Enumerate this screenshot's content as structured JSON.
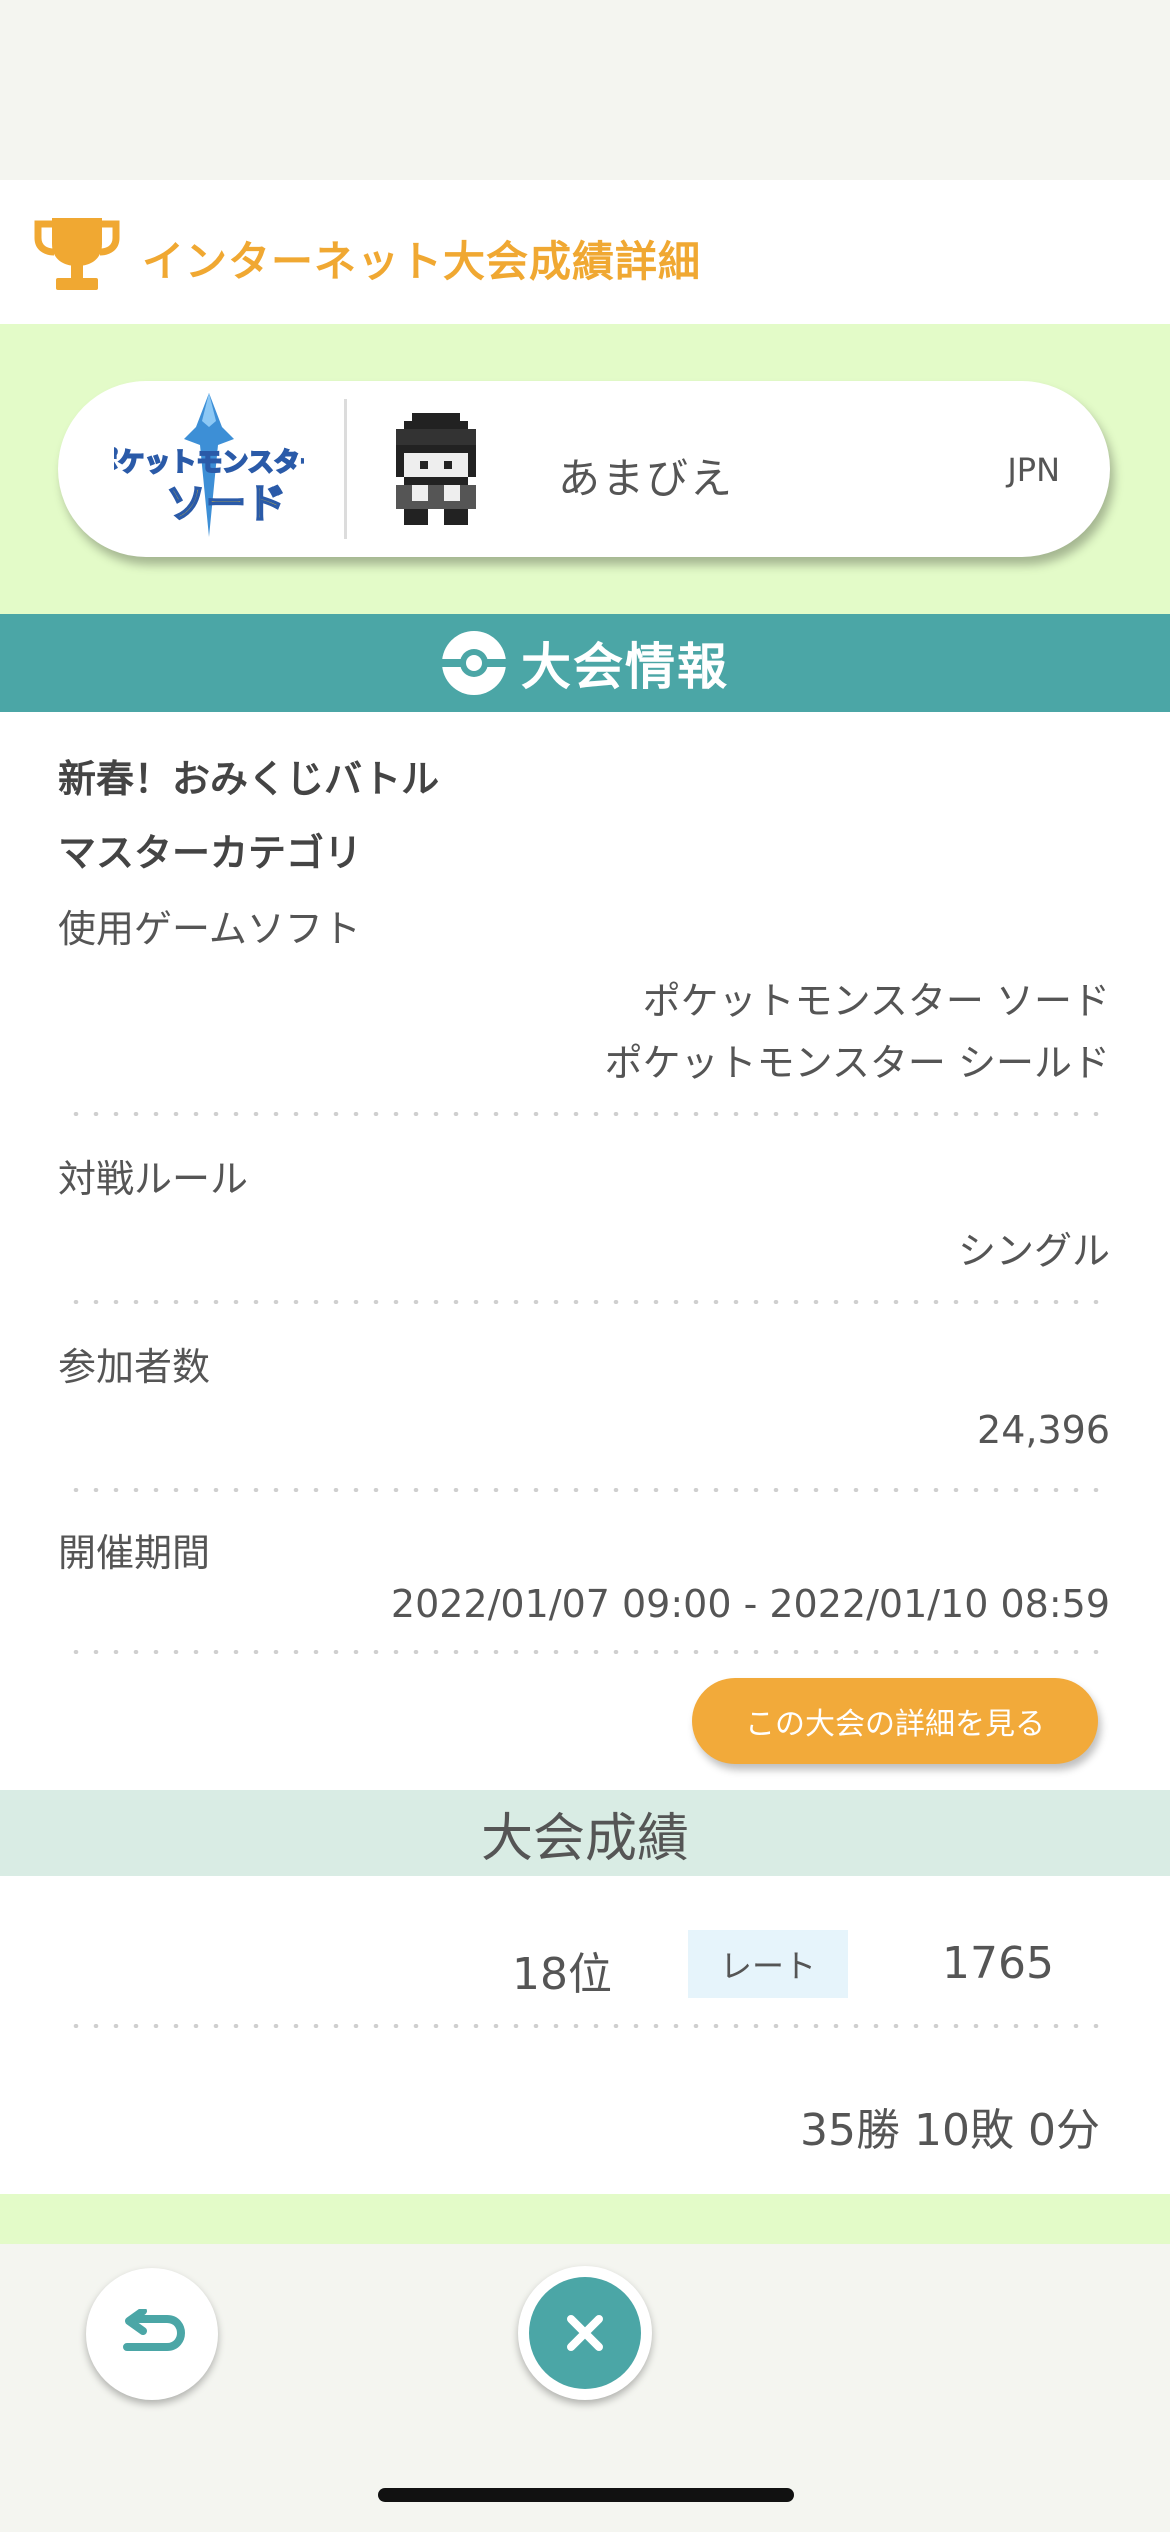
{
  "header": {
    "title": "インターネット大会成績詳細"
  },
  "profile": {
    "name": "あまびえ",
    "region": "JPN",
    "game_logo_lines": [
      "ポケットモンスター",
      "ソード"
    ]
  },
  "section": {
    "title": "大会情報"
  },
  "tournament": {
    "name": "新春！おみくじバトル",
    "category": "マスターカテゴリ",
    "software_label": "使用ゲームソフト",
    "software_values": [
      "ポケットモンスター ソード",
      "ポケットモンスター シールド"
    ],
    "rule_label": "対戦ルール",
    "rule_value": "シングル",
    "participants_label": "参加者数",
    "participants_value": "24,396",
    "period_label": "開催期間",
    "period_value": "2022/01/07 09:00 - 2022/01/10 08:59",
    "detail_button": "この大会の詳細を見る"
  },
  "results": {
    "title": "大会成績",
    "rank": "18位",
    "rate_label": "レート",
    "rate_value": "1765",
    "record": "35勝 10敗 0分"
  },
  "colors": {
    "accent_orange": "#f0a832",
    "teal": "#4ba6a6",
    "light_green": "#e3fbc8"
  },
  "icons": {
    "header": "trophy-icon",
    "section": "pokeball-icon",
    "back": "back-arrow-icon",
    "close": "close-icon"
  }
}
